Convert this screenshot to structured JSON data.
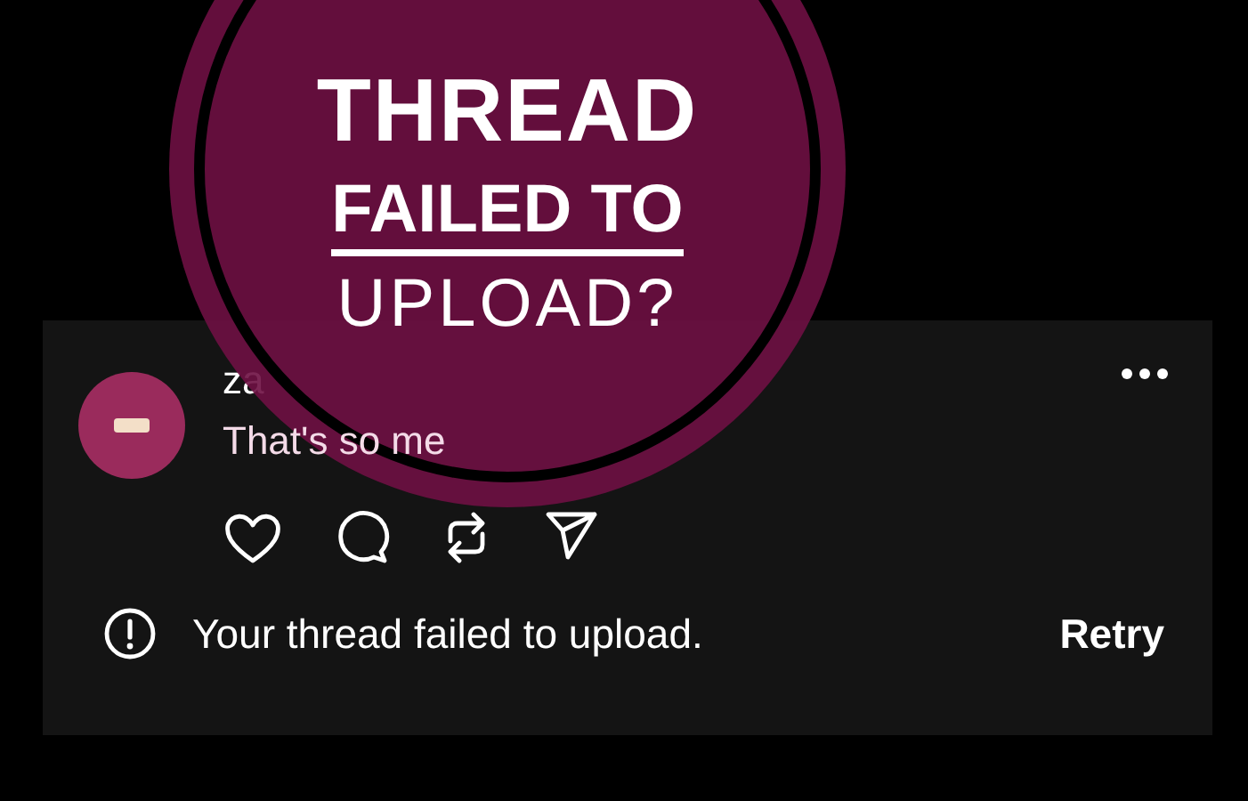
{
  "title_badge": {
    "lines": [
      {
        "text": "THREAD",
        "kind": "bold"
      },
      {
        "text": "FAILED TO",
        "kind": "underlined"
      },
      {
        "text": "UPLOAD?",
        "kind": "thin"
      }
    ]
  },
  "post": {
    "username": "za",
    "text": "That's so me"
  },
  "upload_error": {
    "message": "Your thread failed to upload.",
    "action": "Retry"
  }
}
